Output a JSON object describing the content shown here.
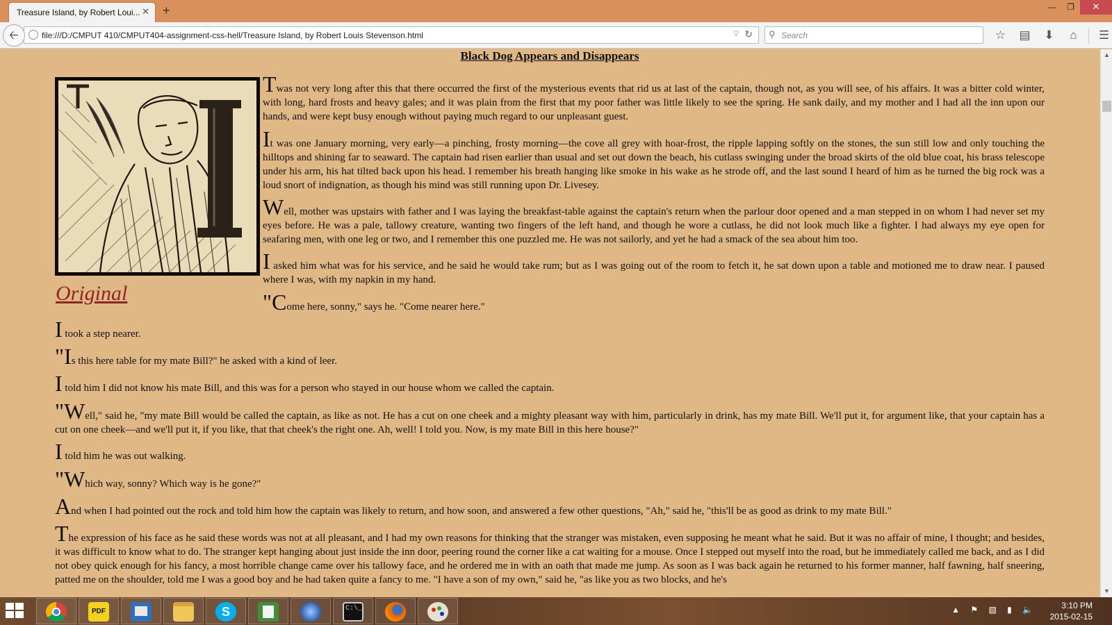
{
  "browser": {
    "tab_title": "Treasure Island, by Robert Loui...",
    "tab_close": "✕",
    "new_tab": "+",
    "url": "file:///D:/CMPUT 410/CMPUT404-assignment-css-hell/Treasure Island, by Robert Louis Stevenson.html",
    "search_placeholder": "Search",
    "icons": [
      "bookmark-star-icon",
      "reading-list-icon",
      "download-icon",
      "home-icon",
      "menu-icon"
    ]
  },
  "page": {
    "chapter_title": "Black Dog Appears and Disappears",
    "original_link": "Original",
    "paragraphs": [
      {
        "dc": "T",
        "text": "was not very long after this that there occurred the first of the mysterious events that rid us at last of the captain, though not, as you will see, of his affairs. It was a bitter cold winter, with long, hard frosts and heavy gales; and it was plain from the first that my poor father was little likely to see the spring. He sank daily, and my mother and I had all the inn upon our hands, and were kept busy enough without paying much regard to our unpleasant guest."
      },
      {
        "dc": "I",
        "text": "t was one January morning, very early—a pinching, frosty morning—the cove all grey with hoar-frost, the ripple lapping softly on the stones, the sun still low and only touching the hilltops and shining far to seaward. The captain had risen earlier than usual and set out down the beach, his cutlass swinging under the broad skirts of the old blue coat, his brass telescope under his arm, his hat tilted back upon his head. I remember his breath hanging like smoke in his wake as he strode off, and the last sound I heard of him as he turned the big rock was a loud snort of indignation, as though his mind was still running upon Dr. Livesey."
      },
      {
        "dc": "W",
        "text": "ell, mother was upstairs with father and I was laying the breakfast-table against the captain's return when the parlour door opened and a man stepped in on whom I had never set my eyes before. He was a pale, tallowy creature, wanting two fingers of the left hand, and though he wore a cutlass, he did not look much like a fighter. I had always my eye open for seafaring men, with one leg or two, and I remember this one puzzled me. He was not sailorly, and yet he had a smack of the sea about him too."
      },
      {
        "dc": "I",
        "text": " asked him what was for his service, and he said he would take rum; but as I was going out of the room to fetch it, he sat down upon a table and motioned me to draw near. I paused where I was, with my napkin in my hand."
      },
      {
        "dc": "\"C",
        "text": "ome here, sonny,\" says he. \"Come nearer here.\""
      },
      {
        "dc": "I",
        "text": " took a step nearer."
      },
      {
        "dc": "\"I",
        "text": "s this here table for my mate Bill?\" he asked with a kind of leer."
      },
      {
        "dc": "I",
        "text": " told him I did not know his mate Bill, and this was for a person who stayed in our house whom we called the captain."
      },
      {
        "dc": "\"W",
        "text": "ell,\" said he, \"my mate Bill would be called the captain, as like as not. He has a cut on one cheek and a mighty pleasant way with him, particularly in drink, has my mate Bill. We'll put it, for argument like, that your captain has a cut on one cheek—and we'll put it, if you like, that that cheek's the right one. Ah, well! I told you. Now, is my mate Bill in this here house?\""
      },
      {
        "dc": "I",
        "text": " told him he was out walking."
      },
      {
        "dc": "\"W",
        "text": "hich way, sonny? Which way is he gone?\""
      },
      {
        "dc": "A",
        "text": "nd when I had pointed out the rock and told him how the captain was likely to return, and how soon, and answered a few other questions, \"Ah,\" said he, \"this'll be as good as drink to my mate Bill.\""
      },
      {
        "dc": "T",
        "text": "he expression of his face as he said these words was not at all pleasant, and I had my own reasons for thinking that the stranger was mistaken, even supposing he meant what he said. But it was no affair of mine, I thought; and besides, it was difficult to know what to do. The stranger kept hanging about just inside the inn door, peering round the corner like a cat waiting for a mouse. Once I stepped out myself into the road, but he immediately called me back, and as I did not obey quick enough for his fancy, a most horrible change came over his tallowy face, and he ordered me in with an oath that made me jump. As soon as I was back again he returned to his former manner, half fawning, half sneering, patted me on the shoulder, told me I was a good boy and he had taken quite a fancy to me. \"I have a son of my own,\" said he, \"as like you as two blocks, and he's"
      }
    ]
  },
  "taskbar": {
    "apps": [
      "chrome",
      "pdf-reader",
      "network-tool",
      "file-explorer",
      "skype",
      "spreadsheet",
      "web-browser-alt",
      "command-prompt",
      "firefox",
      "paint"
    ],
    "time": "3:10 PM",
    "date": "2015-02-15"
  },
  "colors": {
    "page_bg": "#dfb886",
    "title_bar": "#d9905a",
    "link": "#8f2424"
  }
}
